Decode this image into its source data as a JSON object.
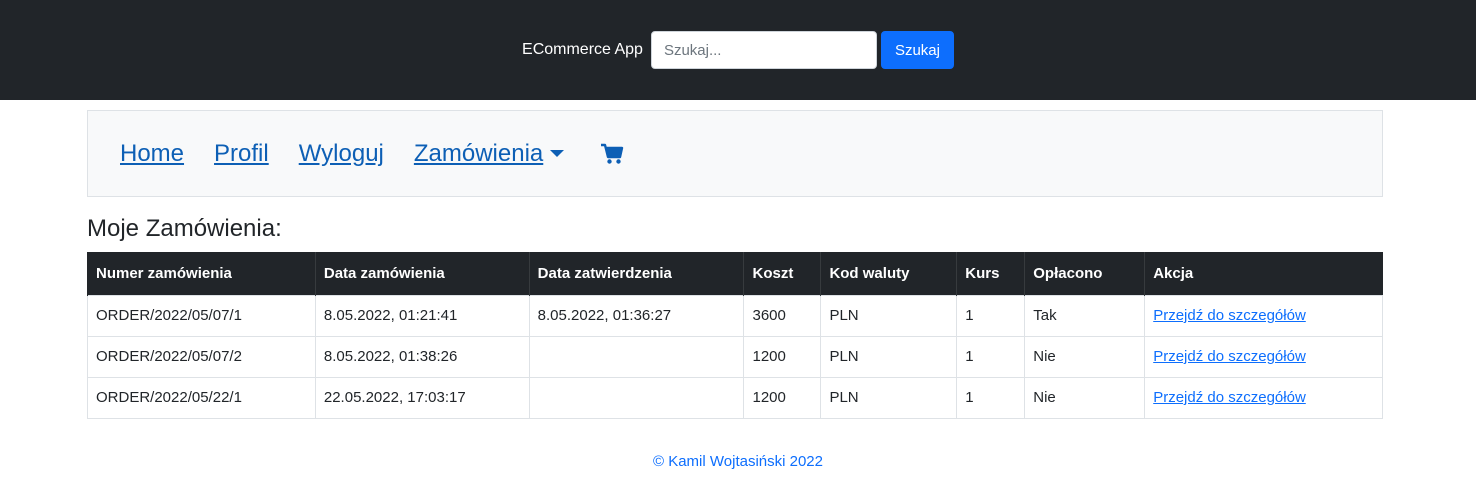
{
  "header": {
    "brand": "ECommerce App",
    "search_placeholder": "Szukaj...",
    "search_button": "Szukaj"
  },
  "nav": {
    "home": "Home",
    "profile": "Profil",
    "logout": "Wyloguj",
    "orders": "Zamówienia",
    "cart_icon": "shopping-cart-icon"
  },
  "page": {
    "title": "Moje Zamówienia:"
  },
  "table": {
    "headers": [
      "Numer zamówienia",
      "Data zamówienia",
      "Data zatwierdzenia",
      "Koszt",
      "Kod waluty",
      "Kurs",
      "Opłacono",
      "Akcja"
    ],
    "rows": [
      [
        "ORDER/2022/05/07/1",
        "8.05.2022, 01:21:41",
        "8.05.2022, 01:36:27",
        "3600",
        "PLN",
        "1",
        "Tak",
        "Przejdź do szczegółów"
      ],
      [
        "ORDER/2022/05/07/2",
        "8.05.2022, 01:38:26",
        "",
        "1200",
        "PLN",
        "1",
        "Nie",
        "Przejdź do szczegółów"
      ],
      [
        "ORDER/2022/05/22/1",
        "22.05.2022, 17:03:17",
        "",
        "1200",
        "PLN",
        "1",
        "Nie",
        "Przejdź do szczegółów"
      ]
    ]
  },
  "footer": {
    "text": "© Kamil Wojtasiński 2022"
  },
  "colors": {
    "header_bg": "#212529",
    "primary": "#0d6efd",
    "nav_bg": "#f8f9fa"
  }
}
